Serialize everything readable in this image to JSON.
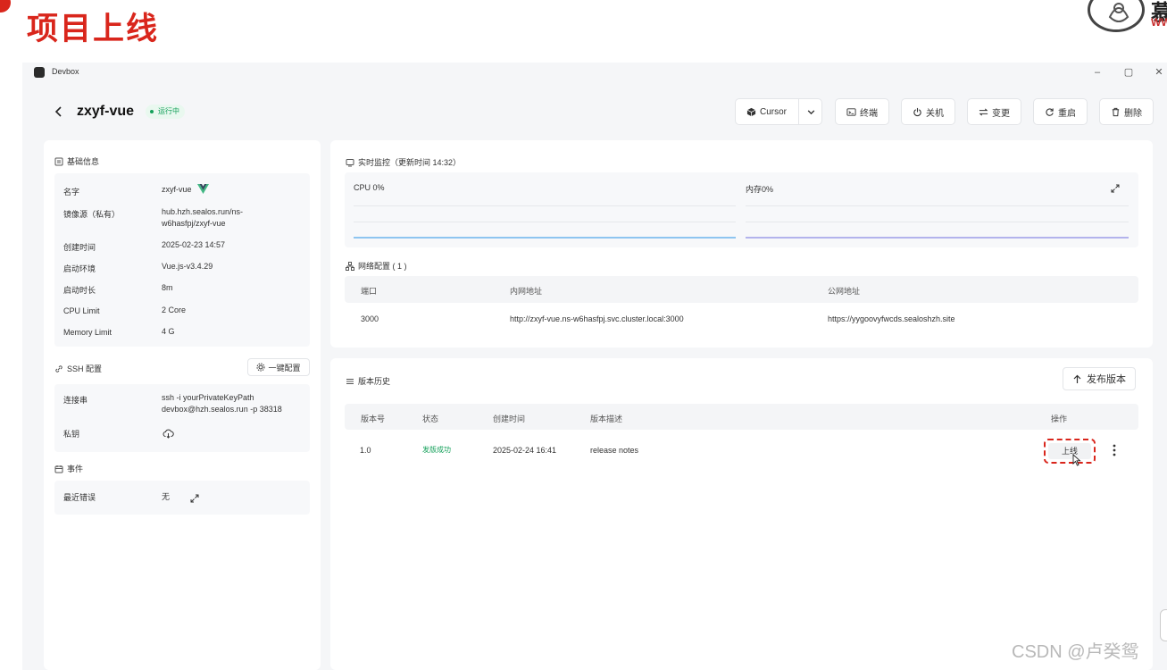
{
  "slide": {
    "title": "项目上线",
    "logo_text": "慕",
    "logo_sub": "WW"
  },
  "window": {
    "app_name": "Devbox",
    "minimize": "–",
    "maximize": "▢",
    "close": "✕"
  },
  "header": {
    "title": "zxyf-vue",
    "status": "运行中",
    "ide": "Cursor",
    "terminal": "终端",
    "shutdown": "关机",
    "change": "变更",
    "restart": "重启",
    "delete": "删除"
  },
  "basic": {
    "title": "基础信息",
    "rows": [
      {
        "label": "名字",
        "value": "zxyf-vue"
      },
      {
        "label": "镜像源（私有）",
        "value": "hub.hzh.sealos.run/ns-w6hasfpj/zxyf-vue"
      },
      {
        "label": "创建时间",
        "value": "2025-02-23 14:57"
      },
      {
        "label": "启动环境",
        "value": "Vue.js-v3.4.29"
      },
      {
        "label": "启动时长",
        "value": "8m"
      },
      {
        "label": "CPU Limit",
        "value": "2 Core"
      },
      {
        "label": "Memory Limit",
        "value": "4 G"
      }
    ]
  },
  "ssh": {
    "title": "SSH 配置",
    "config_button": "一键配置",
    "conn_label": "连接串",
    "conn_value": "ssh -i yourPrivateKeyPath devbox@hzh.sealos.run -p 38318",
    "key_label": "私钥"
  },
  "events": {
    "title": "事件",
    "recent_label": "最近错误",
    "recent_value": "无"
  },
  "monitor": {
    "title": "实时监控（更新时间 14:32）",
    "cpu_label": "CPU 0%",
    "mem_label": "内存0%",
    "cpu_color": "#8ec5f0",
    "mem_color": "#b3b3ec"
  },
  "network": {
    "title": "网络配置 ( 1 )",
    "headers": [
      "端口",
      "内网地址",
      "公网地址"
    ],
    "rows": [
      {
        "port": "3000",
        "internal": "http://zxyf-vue.ns-w6hasfpj.svc.cluster.local:3000",
        "public": "https://yygoovyfwcds.sealoshzh.site"
      }
    ]
  },
  "history": {
    "title": "版本历史",
    "publish_button": "发布版本",
    "headers": [
      "版本号",
      "状态",
      "创建时间",
      "版本描述",
      "操作"
    ],
    "rows": [
      {
        "version": "1.0",
        "status": "发版成功",
        "created": "2025-02-24 16:41",
        "desc": "release notes",
        "action": "上线"
      }
    ]
  },
  "watermark": "CSDN @卢癸鸳"
}
